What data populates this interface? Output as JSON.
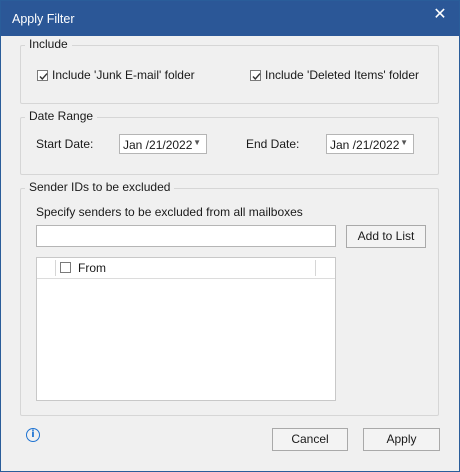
{
  "window": {
    "title": "Apply Filter",
    "close_icon": "✕"
  },
  "include": {
    "legend": "Include",
    "junk_label": "Include 'Junk E-mail' folder",
    "junk_checked": true,
    "deleted_label": "Include 'Deleted Items' folder",
    "deleted_checked": true
  },
  "date_range": {
    "legend": "Date Range",
    "start_label": "Start Date:",
    "start_value": "Jan /21/2022",
    "end_label": "End Date:",
    "end_value": "Jan /21/2022",
    "dropdown_glyph": "▼"
  },
  "sender": {
    "legend": "Sender IDs to be excluded",
    "instructions": "Specify senders to be excluded from all mailboxes",
    "input_value": "",
    "add_button": "Add to List",
    "list_header": "From",
    "list_header_checked": false,
    "rows": []
  },
  "footer": {
    "info_icon": "i",
    "cancel_label": "Cancel",
    "apply_label": "Apply"
  },
  "colors": {
    "titlebar": "#2b5797",
    "accent": "#1e73d2"
  }
}
